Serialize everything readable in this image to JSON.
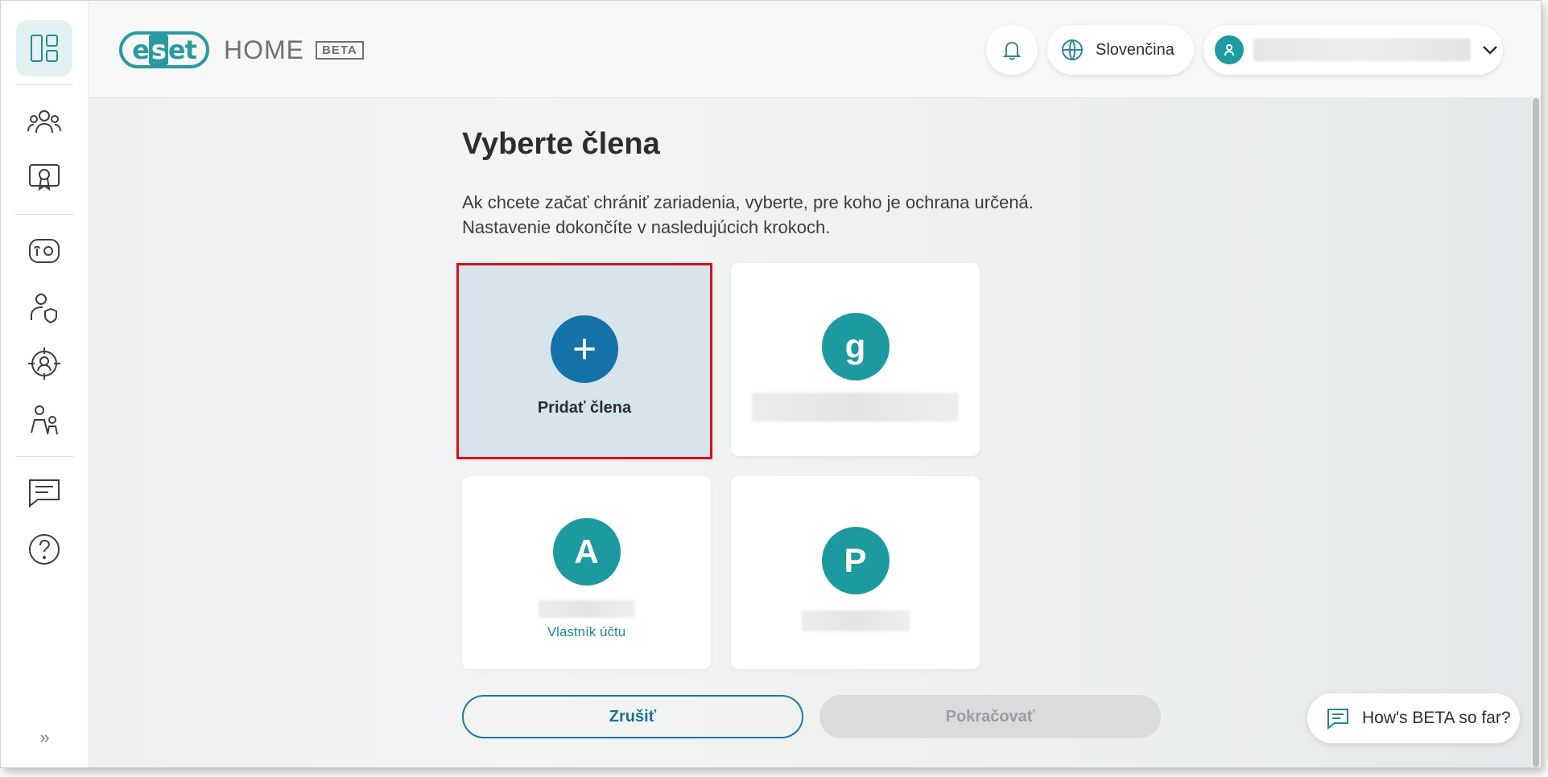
{
  "header": {
    "logo_text": "eset",
    "product": "HOME",
    "badge": "BETA",
    "language": "Slovenčina"
  },
  "sidebar": {
    "items": [
      {
        "name": "dashboard",
        "icon": "dashboard-icon",
        "active": true
      },
      {
        "name": "family",
        "icon": "people-icon"
      },
      {
        "name": "licenses",
        "icon": "license-icon"
      },
      {
        "name": "devices",
        "icon": "device-settings-icon"
      },
      {
        "name": "identity",
        "icon": "user-shield-icon"
      },
      {
        "name": "threats",
        "icon": "target-icon"
      },
      {
        "name": "parental",
        "icon": "family-icon"
      },
      {
        "name": "messages",
        "icon": "message-icon"
      },
      {
        "name": "help",
        "icon": "help-icon"
      }
    ],
    "expand_label": "»"
  },
  "main": {
    "title": "Vyberte člena",
    "description_line1": "Ak chcete začať chrániť zariadenia, vyberte, pre koho je ochrana určená.",
    "description_line2": "Nastavenie dokončíte v nasledujúcich krokoch.",
    "add_card": {
      "icon": "+",
      "label": "Pridať člena"
    },
    "members": [
      {
        "initial": "g",
        "role": ""
      },
      {
        "initial": "A",
        "role": "Vlastník účtu"
      },
      {
        "initial": "P",
        "role": ""
      }
    ],
    "cancel_label": "Zrušiť",
    "continue_label": "Pokračovať",
    "feedback_label": "How's BETA so far?"
  },
  "colors": {
    "accent": "#1d9aa0",
    "primary_blue": "#1572a8",
    "highlight_border": "#d6121c"
  }
}
